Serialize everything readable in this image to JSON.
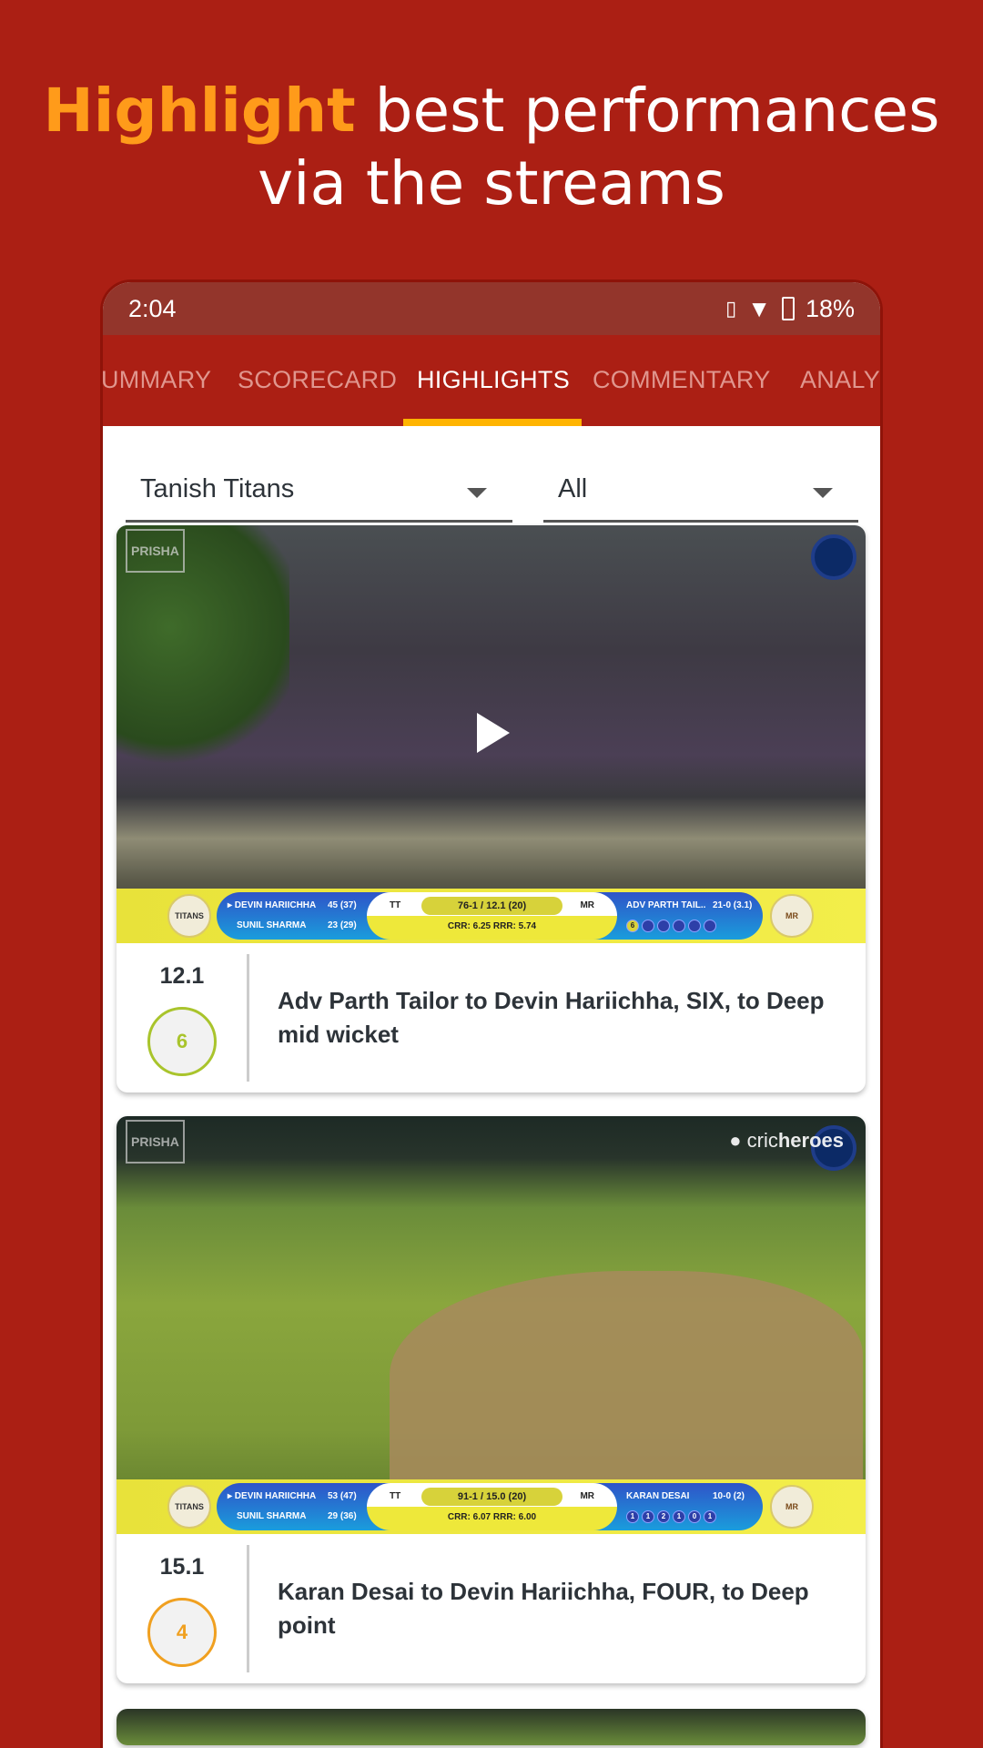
{
  "headline": {
    "accent": "Highlight",
    "line1_rest": " best performances",
    "line2": "via the streams"
  },
  "status_bar": {
    "time": "2:04",
    "battery": "18%",
    "icons": [
      "vibrate-icon",
      "wifi-icon",
      "battery-charging-icon"
    ]
  },
  "tabs": [
    {
      "label": "UMMARY"
    },
    {
      "label": "SCORECARD"
    },
    {
      "label": "HIGHLIGHTS",
      "active": true
    },
    {
      "label": "COMMENTARY"
    },
    {
      "label": "ANALY"
    }
  ],
  "filters": {
    "team": "Tanish Titans",
    "type": "All"
  },
  "colors": {
    "background": "#ab1f14",
    "accent": "#ff9b1a",
    "tab_indicator": "#ffb400",
    "six": "#a9c42c",
    "four": "#f0a020"
  },
  "highlights": [
    {
      "over": "12.1",
      "runs": "6",
      "description": "Adv Parth Tailor to Devin Hariichha, SIX,  to Deep mid wicket",
      "scoreboard": {
        "striker": "▸ DEVIN HARIICHHA",
        "striker_score": "45 (37)",
        "non_striker": "SUNIL SHARMA",
        "non_striker_score": "23 (29)",
        "team1": "TT",
        "score": "76-1 / 12.1 (20)",
        "team2": "MR",
        "rates": "CRR: 6.25  RRR: 5.74",
        "bowler": "ADV PARTH TAIL..",
        "bowler_figures": "21-0 (3.1)",
        "balls": [
          "6",
          "",
          "",
          "",
          "",
          ""
        ],
        "logo_left": "TITANS",
        "logo_right": "MR ROYALS"
      },
      "watermarks": {
        "left": "PRISHA"
      }
    },
    {
      "over": "15.1",
      "runs": "4",
      "description": "Karan Desai to Devin Hariichha, FOUR,  to Deep point",
      "scoreboard": {
        "striker": "▸ DEVIN HARIICHHA",
        "striker_score": "53 (47)",
        "non_striker": "SUNIL SHARMA",
        "non_striker_score": "29 (36)",
        "team1": "TT",
        "score": "91-1 / 15.0 (20)",
        "team2": "MR",
        "rates": "CRR: 6.07  RRR: 6.00",
        "bowler": "KARAN DESAI",
        "bowler_figures": "10-0 (2)",
        "balls": [
          "1",
          "1",
          "2",
          "1",
          "0",
          "1"
        ],
        "logo_left": "TITANS",
        "logo_right": "MR ROYALS"
      },
      "watermarks": {
        "left": "PRISHA",
        "right": "cricheroes"
      }
    }
  ]
}
